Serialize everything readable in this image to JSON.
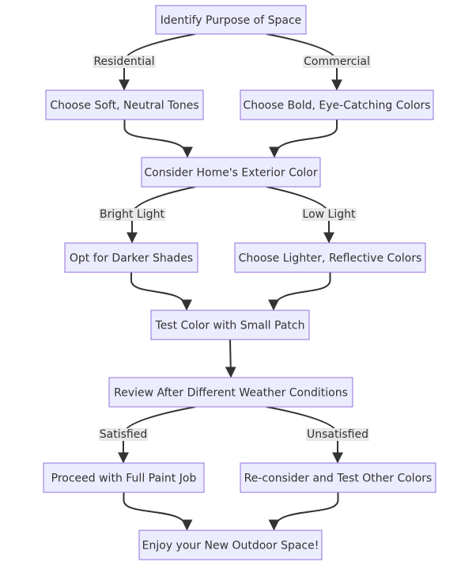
{
  "diagram": {
    "type": "flowchart",
    "direction": "top-down",
    "colors": {
      "node_fill": "#ECECFF",
      "node_stroke": "#9370DB",
      "edge": "#333333",
      "label_bg": "#e8e8e8",
      "text": "#333333"
    },
    "nodes": [
      {
        "id": "A",
        "label": "Identify Purpose of Space"
      },
      {
        "id": "B",
        "label": "Choose Soft, Neutral Tones"
      },
      {
        "id": "C",
        "label": "Choose Bold, Eye-Catching Colors"
      },
      {
        "id": "D",
        "label": "Consider Home's Exterior Color"
      },
      {
        "id": "E",
        "label": "Opt for Darker Shades"
      },
      {
        "id": "F",
        "label": "Choose Lighter, Reflective Colors"
      },
      {
        "id": "G",
        "label": "Test Color with Small Patch"
      },
      {
        "id": "H",
        "label": "Review After Different Weather Conditions"
      },
      {
        "id": "I",
        "label": "Proceed with Full Paint Job"
      },
      {
        "id": "J",
        "label": "Re-consider and Test Other Colors"
      },
      {
        "id": "K",
        "label": "Enjoy your New Outdoor Space!"
      }
    ],
    "edges": [
      {
        "from": "A",
        "to": "B",
        "label": "Residential"
      },
      {
        "from": "A",
        "to": "C",
        "label": "Commercial"
      },
      {
        "from": "B",
        "to": "D",
        "label": ""
      },
      {
        "from": "C",
        "to": "D",
        "label": ""
      },
      {
        "from": "D",
        "to": "E",
        "label": "Bright Light"
      },
      {
        "from": "D",
        "to": "F",
        "label": "Low Light"
      },
      {
        "from": "E",
        "to": "G",
        "label": ""
      },
      {
        "from": "F",
        "to": "G",
        "label": ""
      },
      {
        "from": "G",
        "to": "H",
        "label": ""
      },
      {
        "from": "H",
        "to": "I",
        "label": "Satisfied"
      },
      {
        "from": "H",
        "to": "J",
        "label": "Unsatisfied"
      },
      {
        "from": "I",
        "to": "K",
        "label": ""
      },
      {
        "from": "J",
        "to": "K",
        "label": ""
      }
    ]
  }
}
